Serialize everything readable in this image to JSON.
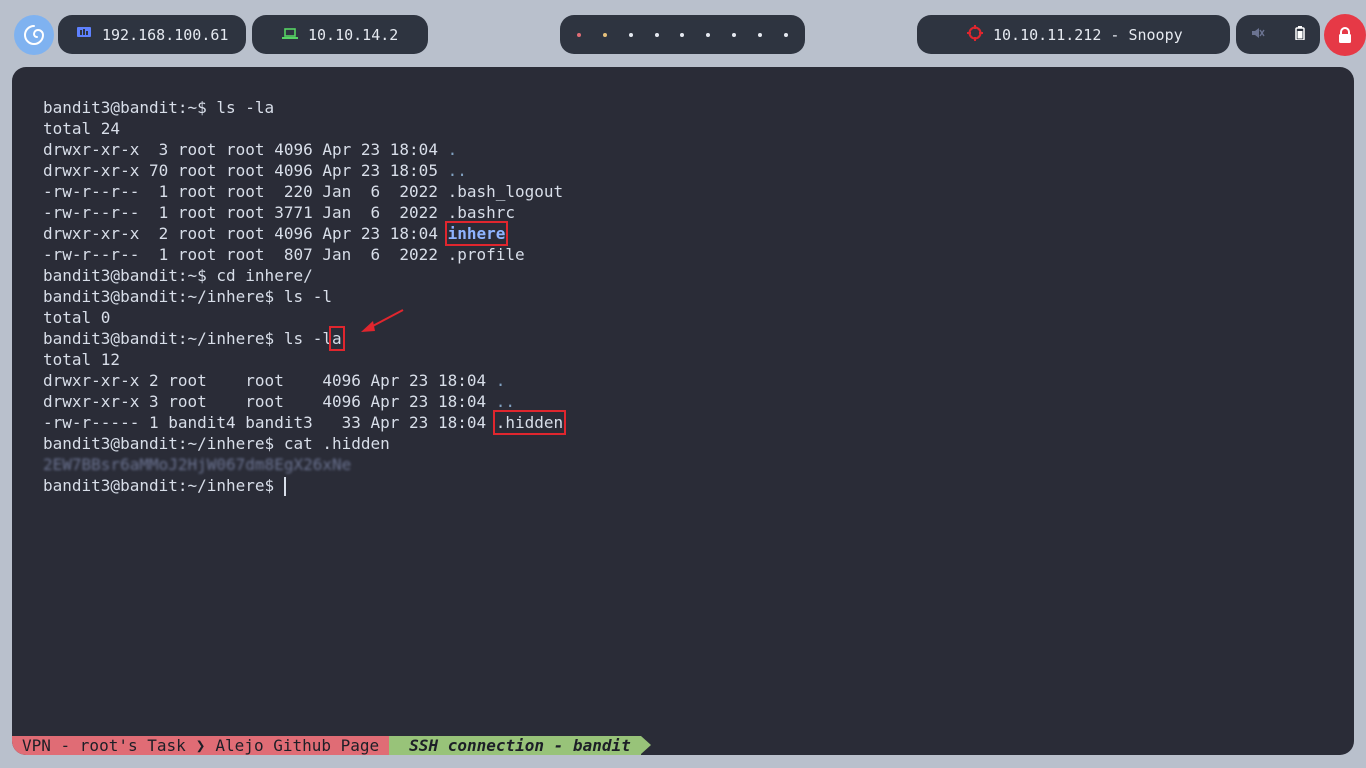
{
  "topbar": {
    "host_ip": "192.168.100.61",
    "vpn_ip": "10.10.14.2",
    "target": "10.10.11.212 - Snoopy",
    "dot_colors": [
      "#e06c75",
      "#e5c07b",
      "#e5e9f0",
      "#e5e9f0",
      "#e5e9f0",
      "#e5e9f0",
      "#e5e9f0",
      "#e5e9f0",
      "#e5e9f0"
    ],
    "accent_red": "#e63946"
  },
  "terminal": {
    "lines": [
      {
        "parts": [
          {
            "t": "bandit3@bandit:~$ ls -la"
          }
        ]
      },
      {
        "parts": [
          {
            "t": "total 24"
          }
        ]
      },
      {
        "parts": [
          {
            "t": "drwxr-xr-x  3 root root 4096 Apr 23 18:04 "
          },
          {
            "t": ".",
            "c": "blue"
          }
        ]
      },
      {
        "parts": [
          {
            "t": "drwxr-xr-x 70 root root 4096 Apr 23 18:05 "
          },
          {
            "t": "..",
            "c": "blue"
          }
        ]
      },
      {
        "parts": [
          {
            "t": "-rw-r--r--  1 root root  220 Jan  6  2022 .bash_logout"
          }
        ]
      },
      {
        "parts": [
          {
            "t": "-rw-r--r--  1 root root 3771 Jan  6  2022 .bashrc"
          }
        ]
      },
      {
        "parts": [
          {
            "t": "drwxr-xr-x  2 root root 4096 Apr 23 18:04 "
          },
          {
            "t": "inhere",
            "c": "bold-blue",
            "box": true
          }
        ]
      },
      {
        "parts": [
          {
            "t": "-rw-r--r--  1 root root  807 Jan  6  2022 .profile"
          }
        ]
      },
      {
        "parts": [
          {
            "t": "bandit3@bandit:~$ cd inhere/"
          }
        ]
      },
      {
        "parts": [
          {
            "t": "bandit3@bandit:~/inhere$ ls -l"
          }
        ]
      },
      {
        "parts": [
          {
            "t": "total 0"
          }
        ]
      },
      {
        "parts": [
          {
            "t": "bandit3@bandit:~/inhere$ ls -l"
          },
          {
            "t": "a",
            "box": true,
            "arrow": true
          }
        ]
      },
      {
        "parts": [
          {
            "t": "total 12"
          }
        ]
      },
      {
        "parts": [
          {
            "t": "drwxr-xr-x 2 root    root    4096 Apr 23 18:04 "
          },
          {
            "t": ".",
            "c": "blue"
          }
        ]
      },
      {
        "parts": [
          {
            "t": "drwxr-xr-x 3 root    root    4096 Apr 23 18:04 "
          },
          {
            "t": "..",
            "c": "blue"
          }
        ]
      },
      {
        "parts": [
          {
            "t": "-rw-r----- 1 bandit4 bandit3   33 Apr 23 18:04 "
          },
          {
            "t": ".hidden",
            "box": true
          }
        ]
      },
      {
        "parts": [
          {
            "t": "bandit3@bandit:~/inhere$ cat .hidden"
          }
        ]
      },
      {
        "parts": [
          {
            "t": "2EW7BBsr6aMMoJ2HjW067dm8EgX26xNe",
            "c": "blurred"
          }
        ]
      },
      {
        "parts": [
          {
            "t": "bandit3@bandit:~/inhere$ "
          }
        ],
        "cursor": true
      }
    ]
  },
  "statusbar": {
    "seg1": "VPN - root's Task",
    "seg2": "Alejo Github Page",
    "seg3": "SSH connection - bandit"
  }
}
